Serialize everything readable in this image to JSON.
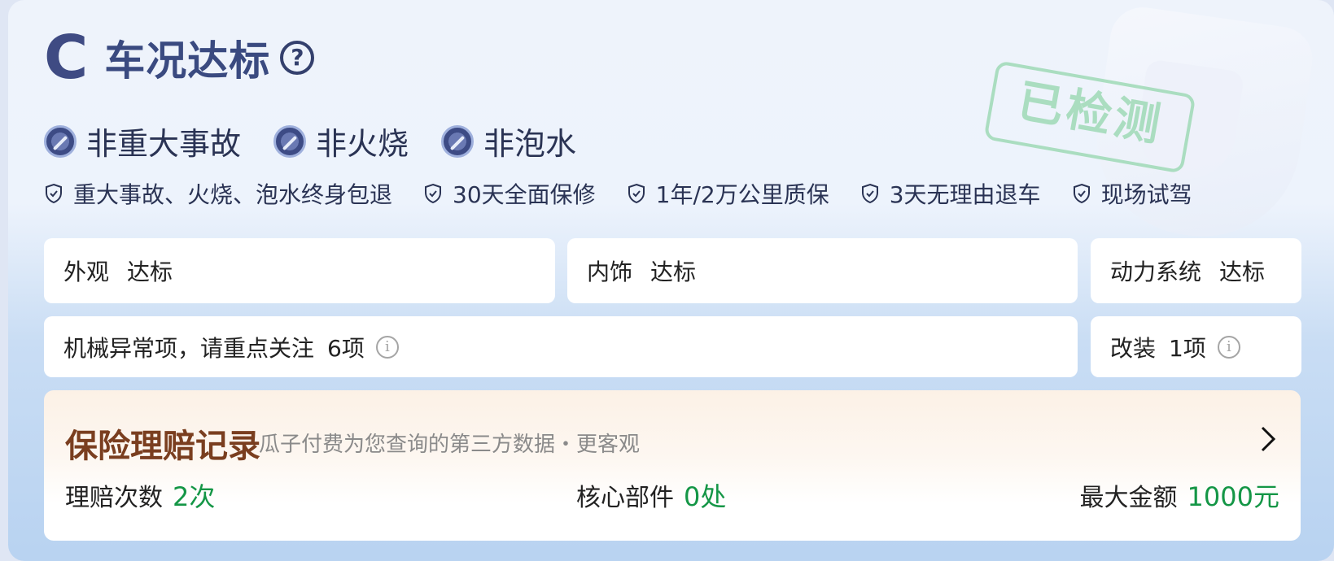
{
  "header": {
    "grade": "C",
    "title": "车况达标"
  },
  "stamp": "已检测",
  "badges": [
    {
      "label": "非重大事故",
      "icon": "no-accident-icon"
    },
    {
      "label": "非火烧",
      "icon": "no-fire-icon"
    },
    {
      "label": "非泡水",
      "icon": "no-water-icon"
    }
  ],
  "guarantees": [
    "重大事故、火烧、泡水终身包退",
    "30天全面保修",
    "1年/2万公里质保",
    "3天无理由退车",
    "现场试驾"
  ],
  "checks": {
    "exterior": {
      "label": "外观",
      "value": "达标"
    },
    "interior": {
      "label": "内饰",
      "value": "达标"
    },
    "power": {
      "label": "动力系统",
      "value": "达标"
    },
    "mechanical": {
      "label": "机械异常项，请重点关注",
      "value": "6项"
    },
    "modification": {
      "label": "改装",
      "value": "1项"
    }
  },
  "insurance": {
    "title": "保险理赔记录",
    "subtitle": "瓜子付费为您查询的第三方数据・更客观",
    "claims": {
      "label": "理赔次数",
      "value": "2次"
    },
    "core_parts": {
      "label": "核心部件",
      "value": "0处"
    },
    "max_amount": {
      "label": "最大金额",
      "value": "1000元"
    }
  },
  "colors": {
    "title": "#3a4a80",
    "accent_green": "#149646",
    "insurance_title": "#7a3e1f"
  }
}
